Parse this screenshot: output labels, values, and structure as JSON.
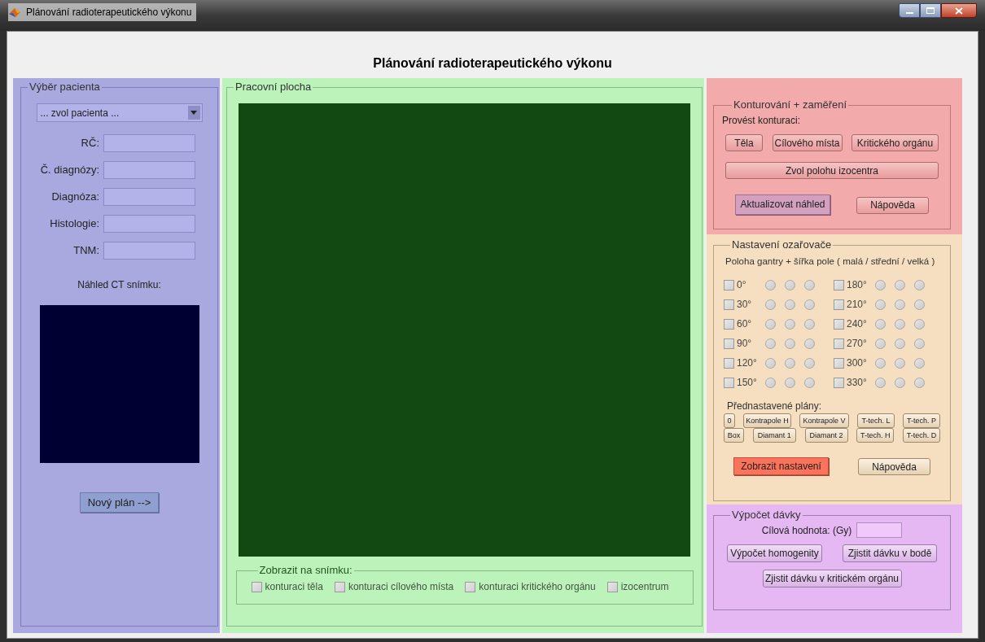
{
  "window": {
    "title": "Plánování radioterapeutického výkonu"
  },
  "header": {
    "title": "Plánování radioterapeutického výkonu"
  },
  "patient_panel": {
    "legend": "Výběr pacienta",
    "dropdown": {
      "value": "... zvol pacienta ..."
    },
    "fields": [
      {
        "label": "RČ:"
      },
      {
        "label": "Č. diagnózy:"
      },
      {
        "label": "Diagnóza:"
      },
      {
        "label": "Histologie:"
      },
      {
        "label": "TNM:"
      }
    ],
    "preview_label": "Náhled CT snímku:",
    "new_plan_button": "Nový plán -->"
  },
  "workspace": {
    "legend": "Pracovní plocha",
    "display": {
      "legend": "Zobrazit na snímku:",
      "options": [
        {
          "label": "konturaci těla",
          "checked": false
        },
        {
          "label": "konturaci cílového místa",
          "checked": false
        },
        {
          "label": "konturaci kritického orgánu",
          "checked": false
        },
        {
          "label": "izocentrum",
          "checked": false
        }
      ]
    }
  },
  "contouring": {
    "legend": "Konturování + zaměření",
    "prompt": "Provést konturaci:",
    "contour_buttons": [
      "Těla",
      "Cílového místa",
      "Kritického orgánu"
    ],
    "isocenter_button": "Zvol polohu izocentra",
    "update_button": "Aktualizovat náhled",
    "help_button": "Nápověda"
  },
  "beam": {
    "legend": "Nastavení ozařovače",
    "header": "Poloha gantry + šířka pole ( malá / střední / velká )",
    "angles": [
      {
        "label": "0°",
        "checked": false,
        "sizes": [
          {
            "selected": false
          },
          {
            "selected": false
          },
          {
            "selected": false
          }
        ]
      },
      {
        "label": "30°",
        "checked": false,
        "sizes": [
          {
            "selected": false
          },
          {
            "selected": false
          },
          {
            "selected": false
          }
        ]
      },
      {
        "label": "60°",
        "checked": false,
        "sizes": [
          {
            "selected": false
          },
          {
            "selected": false
          },
          {
            "selected": false
          }
        ]
      },
      {
        "label": "90°",
        "checked": false,
        "sizes": [
          {
            "selected": false
          },
          {
            "selected": false
          },
          {
            "selected": false
          }
        ]
      },
      {
        "label": "120°",
        "checked": false,
        "sizes": [
          {
            "selected": false
          },
          {
            "selected": false
          },
          {
            "selected": false
          }
        ]
      },
      {
        "label": "150°",
        "checked": false,
        "sizes": [
          {
            "selected": false
          },
          {
            "selected": false
          },
          {
            "selected": false
          }
        ]
      },
      {
        "label": "180°",
        "checked": false,
        "sizes": [
          {
            "selected": false
          },
          {
            "selected": false
          },
          {
            "selected": false
          }
        ]
      },
      {
        "label": "210°",
        "checked": false,
        "sizes": [
          {
            "selected": false
          },
          {
            "selected": false
          },
          {
            "selected": false
          }
        ]
      },
      {
        "label": "240°",
        "checked": false,
        "sizes": [
          {
            "selected": false
          },
          {
            "selected": false
          },
          {
            "selected": false
          }
        ]
      },
      {
        "label": "270°",
        "checked": false,
        "sizes": [
          {
            "selected": false
          },
          {
            "selected": false
          },
          {
            "selected": false
          }
        ]
      },
      {
        "label": "300°",
        "checked": false,
        "sizes": [
          {
            "selected": false
          },
          {
            "selected": false
          },
          {
            "selected": false
          }
        ]
      },
      {
        "label": "330°",
        "checked": false,
        "sizes": [
          {
            "selected": false
          },
          {
            "selected": false
          },
          {
            "selected": false
          }
        ]
      }
    ],
    "presets_label": "Přednastavené plány:",
    "presets": [
      [
        "0",
        "Kontrapole H",
        "Kontrapole V",
        "T-tech. L",
        "T-tech. P"
      ],
      [
        "Box",
        "Diamant 1",
        "Diamant 2",
        "T-tech. H",
        "T-tech. D"
      ]
    ],
    "show_button": "Zobrazit nastavení",
    "help_button": "Nápověda"
  },
  "dose": {
    "legend": "Výpočet dávky",
    "target_label": "Cílová hodnota: (Gy)",
    "buttons": [
      "Výpočet homogenity",
      "Zjistit dávku v bodě"
    ],
    "critical_button": "Zjistit dávku v kritickém orgánu"
  }
}
